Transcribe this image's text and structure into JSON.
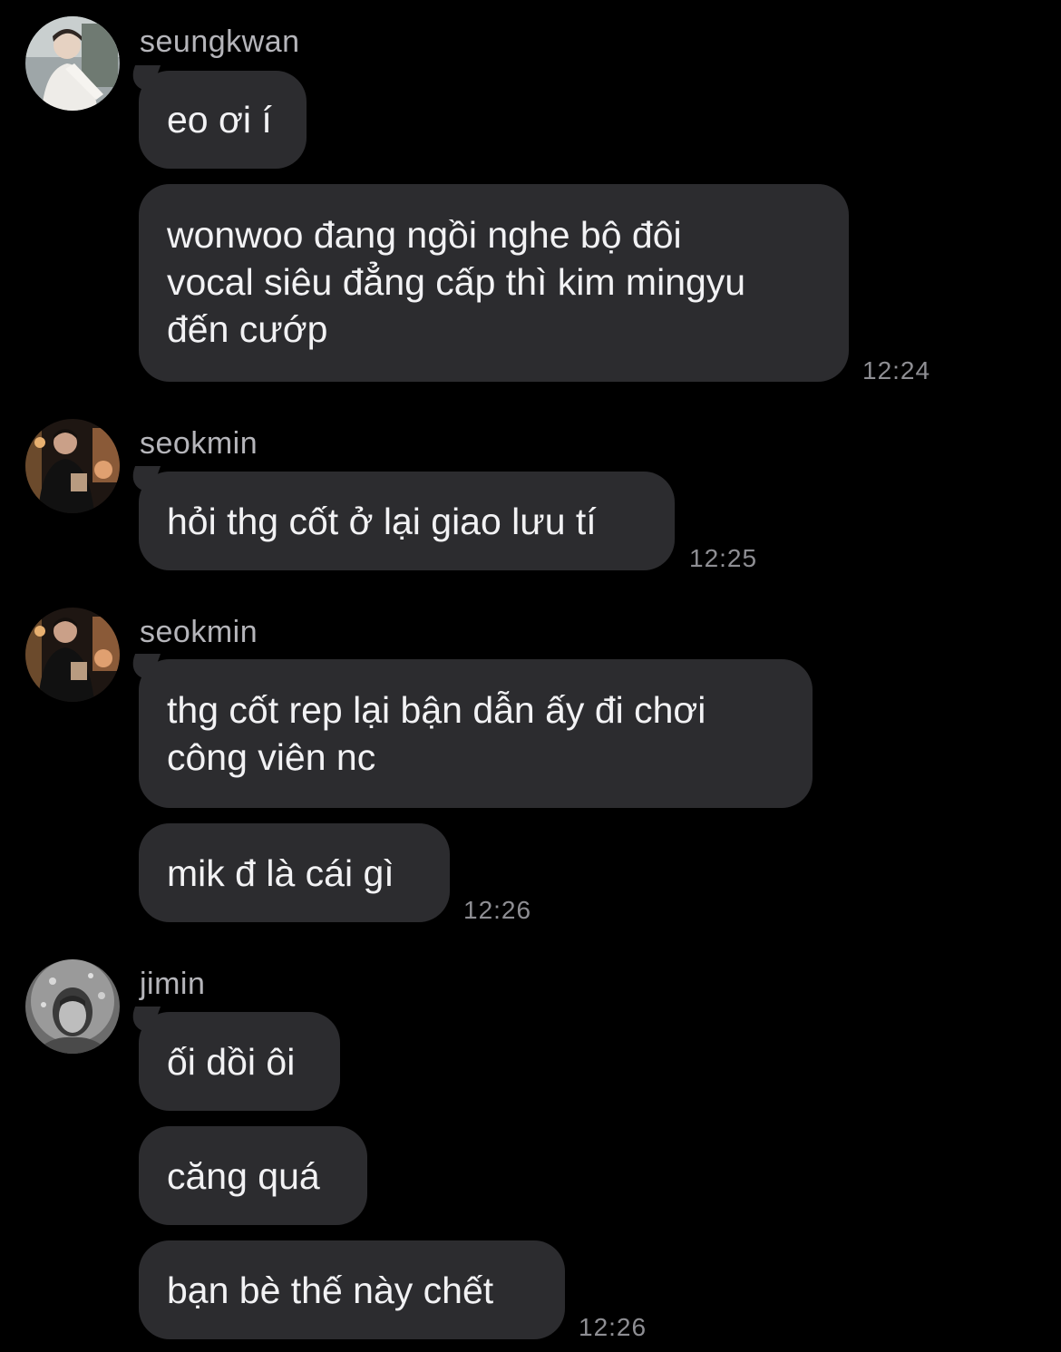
{
  "colors": {
    "background": "#000000",
    "bubble": "#2c2c2f",
    "bubble_text": "#f2f2f4",
    "sender_text": "#b5b5ba",
    "timestamp_text": "#8e8e93"
  },
  "groups": [
    {
      "sender": "seungkwan",
      "avatar_icon": "user-avatar-photo",
      "messages": [
        {
          "text": "eo ơi í"
        },
        {
          "text": "wonwoo đang ngồi nghe bộ đôi vocal siêu đẳng cấp thì kim mingyu đến cướp",
          "lines": [
            "wonwoo đang ngồi nghe bộ đôi",
            "vocal siêu đẳng cấp thì kim mingyu",
            "đến cướp"
          ]
        }
      ],
      "time": "12:24"
    },
    {
      "sender": "seokmin",
      "avatar_icon": "user-avatar-photo",
      "messages": [
        {
          "text": "hỏi thg cốt ở lại giao lưu tí"
        }
      ],
      "time": "12:25"
    },
    {
      "sender": "seokmin",
      "avatar_icon": "user-avatar-photo",
      "messages": [
        {
          "text": "thg cốt rep lại bận dẫn ấy đi chơi công viên nc",
          "lines": [
            "thg cốt rep lại bận dẫn ấy đi chơi",
            "công viên nc"
          ]
        },
        {
          "text": "mik đ là cái gì"
        }
      ],
      "time": "12:26"
    },
    {
      "sender": "jimin",
      "avatar_icon": "user-avatar-photo",
      "messages": [
        {
          "text": "ối dồi ôi"
        },
        {
          "text": "căng quá"
        },
        {
          "text": "bạn bè thế này chết"
        }
      ],
      "time": "12:26"
    }
  ]
}
